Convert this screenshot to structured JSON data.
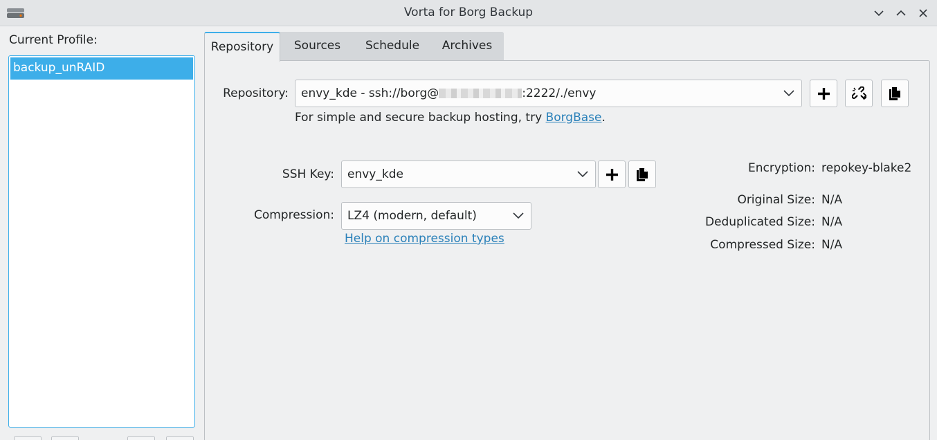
{
  "window": {
    "title": "Vorta for Borg Backup"
  },
  "sidebar": {
    "label": "Current Profile:",
    "profiles": [
      "backup_unRAID"
    ]
  },
  "tabs": [
    {
      "label": "Repository",
      "active": true
    },
    {
      "label": "Sources",
      "active": false
    },
    {
      "label": "Schedule",
      "active": false
    },
    {
      "label": "Archives",
      "active": false
    }
  ],
  "repository": {
    "label": "Repository:",
    "value_prefix": "envy_kde - ssh://borg@",
    "value_suffix": ":2222/./envy",
    "hint_text": "For simple and secure backup hosting, try ",
    "hint_link": "BorgBase",
    "hint_end": "."
  },
  "ssh_key": {
    "label": "SSH Key:",
    "value": "envy_kde"
  },
  "compression": {
    "label": "Compression:",
    "value": "LZ4 (modern, default)",
    "help_link": "Help on compression types"
  },
  "info": {
    "encryption_label": "Encryption:",
    "encryption_value": "repokey-blake2",
    "original_label": "Original Size:",
    "original_value": "N/A",
    "dedup_label": "Deduplicated Size:",
    "dedup_value": "N/A",
    "compressed_label": "Compressed Size:",
    "compressed_value": "N/A"
  },
  "colors": {
    "accent": "#3daee9",
    "link": "#2980b9"
  }
}
